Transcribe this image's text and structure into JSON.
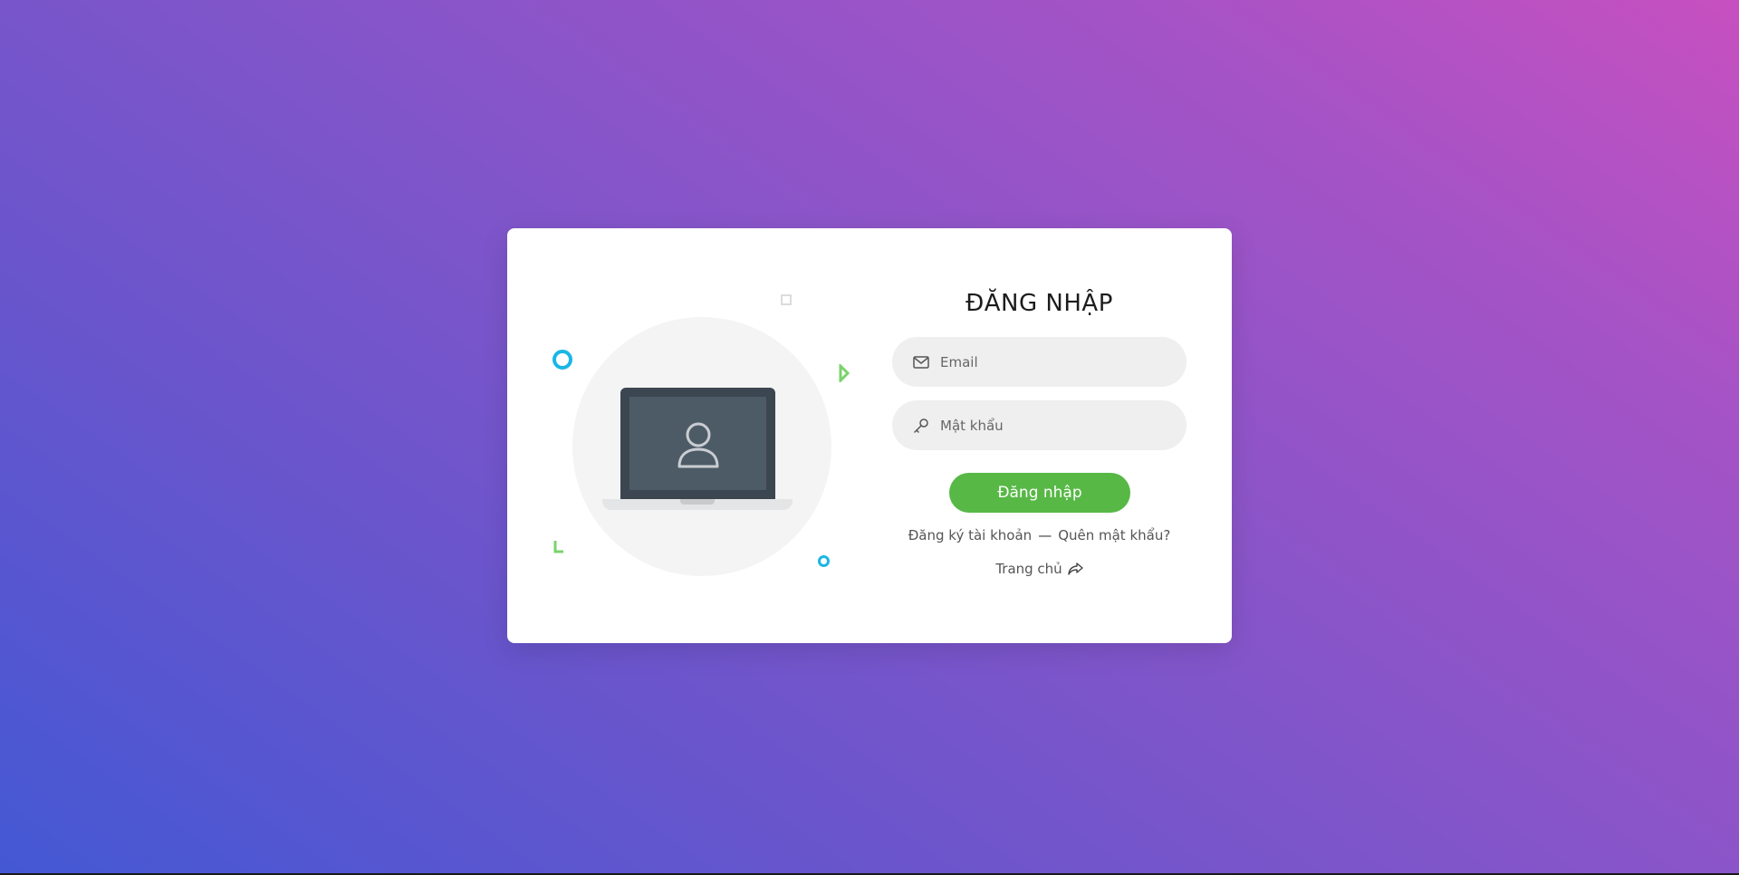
{
  "login": {
    "title": "ĐĂNG NHẬP",
    "email_placeholder": "Email",
    "password_placeholder": "Mật khẩu",
    "submit_label": "Đăng nhập",
    "register_link": "Đăng ký tài khoản",
    "separator": "—",
    "forgot_link": "Quên mật khẩu?",
    "home_link": "Trang chủ"
  },
  "icons": {
    "email": "mail-icon",
    "password": "key-icon",
    "home": "share-arrow-icon",
    "illustration": "laptop-user-icon"
  },
  "colors": {
    "accent": "#57b846",
    "decor_blue": "#1ab6e6",
    "decor_green": "#7ad36b"
  }
}
